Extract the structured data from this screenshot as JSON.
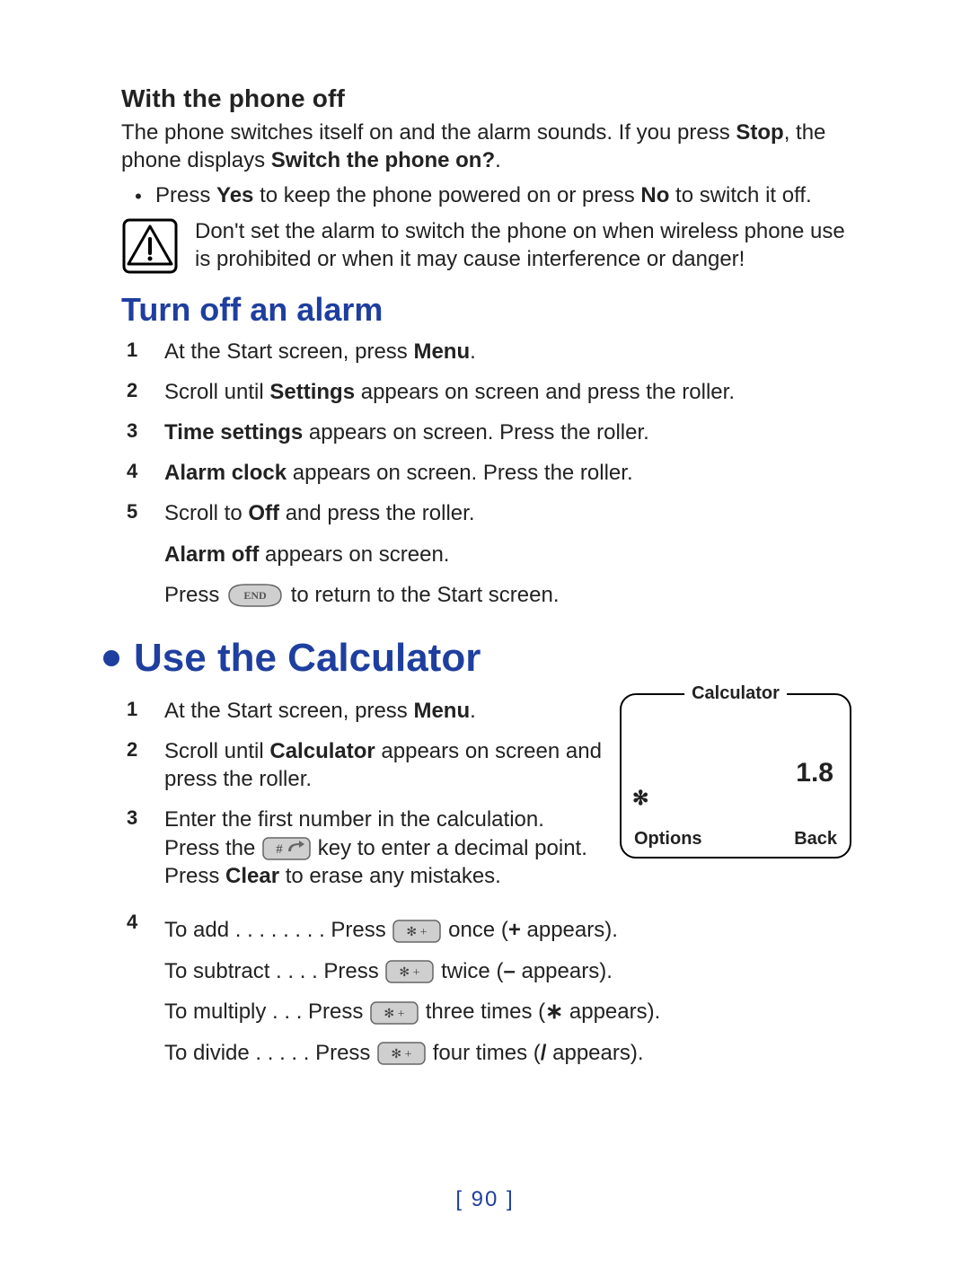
{
  "section_phone_off": {
    "heading": "With the phone off",
    "intro_pre": "The phone switches itself on and the alarm sounds. If you press ",
    "intro_bold1": "Stop",
    "intro_mid": ", the phone displays ",
    "intro_bold2": "Switch the phone on?",
    "intro_post": ".",
    "bullet_pre": "Press ",
    "bullet_b1": "Yes",
    "bullet_mid": " to keep the phone powered on or press ",
    "bullet_b2": "No",
    "bullet_post": " to switch it off.",
    "warning": "Don't set the alarm to switch the phone on when wireless phone use is prohibited or when it may cause interference or danger!"
  },
  "section_turn_off": {
    "heading": "Turn off an alarm",
    "steps": {
      "s1_pre": "At the Start screen, press ",
      "s1_b": "Menu",
      "s1_post": ".",
      "s2_pre": "Scroll until ",
      "s2_b": "Settings",
      "s2_post": " appears on screen and press the roller.",
      "s3_b": "Time settings",
      "s3_post": " appears on screen. Press the roller.",
      "s4_b": "Alarm clock",
      "s4_post": " appears on screen. Press the roller.",
      "s5_pre": "Scroll to ",
      "s5_b": "Off",
      "s5_post": " and press the roller.",
      "s5a_b": "Alarm off",
      "s5a_post": " appears on screen.",
      "s5b_pre": "Press ",
      "s5b_key": "END",
      "s5b_post": " to return to the Start screen."
    }
  },
  "section_calc": {
    "heading": "Use the Calculator",
    "steps": {
      "s1_pre": "At the Start screen, press ",
      "s1_b": "Menu",
      "s1_post": ".",
      "s2_pre": "Scroll until ",
      "s2_b": "Calculator",
      "s2_post": " appears on screen and press the roller.",
      "s3_line1": "Enter the first number in the calculation.",
      "s3_pre": "Press the ",
      "s3_key": "# ⇧",
      "s3_mid": " key to enter a decimal point. Press ",
      "s3_b": "Clear",
      "s3_post": " to erase any mistakes.",
      "s4": {
        "add_label": "To add . . . . . . . . Press ",
        "add_key": "✻ +",
        "add_tail_pre": " once (",
        "add_tail_b": "+",
        "add_tail_post": " appears).",
        "sub_label": "To subtract . . . . Press ",
        "sub_key": "✻ +",
        "sub_tail_pre": " twice (",
        "sub_tail_b": "–",
        "sub_tail_post": " appears).",
        "mul_label": "To multiply  . . . Press ",
        "mul_key": "✻ +",
        "mul_tail_pre": " three times (",
        "mul_tail_b": "∗",
        "mul_tail_post": " appears).",
        "div_label": "To divide  . . . . . Press ",
        "div_key": "✻ +",
        "div_tail_pre": " four times (",
        "div_tail_b": "/",
        "div_tail_post": " appears)."
      }
    },
    "screen": {
      "title": "Calculator",
      "value": "1.8",
      "star": "✻",
      "options": "Options",
      "back": "Back"
    }
  },
  "page_number": "[ 90 ]"
}
